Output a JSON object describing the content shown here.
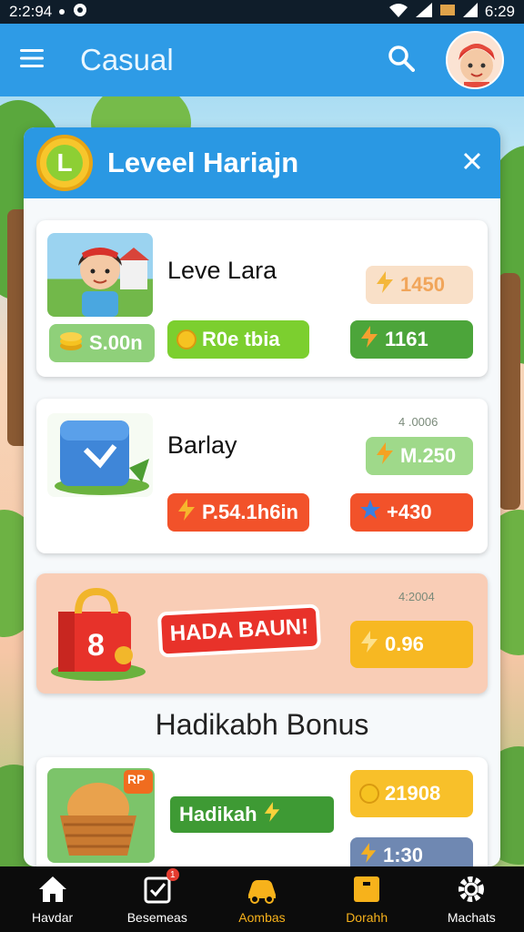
{
  "status_bar": {
    "time_left": "2:2:94",
    "time_right": "6:29"
  },
  "app_bar": {
    "title": "Casual"
  },
  "panel": {
    "title": "Leveel Hariajn",
    "badge_letter": "L",
    "cards": [
      {
        "name": "Leve Lara",
        "coin_pill": "S.00n",
        "mid_pill": "R0e tbia",
        "top_right_pill": "1450",
        "top_right_mini": "",
        "bottom_right_pill": "1161"
      },
      {
        "name": "Barlay",
        "mid_pill": "P.54.1h6in",
        "top_right_mini": "4 .0006",
        "top_right_pill": "M.250",
        "bottom_right_pill": "+430"
      },
      {
        "banner": "HADA BAUN!",
        "gift_number": "8",
        "top_right_mini": "4:2004",
        "right_pill": "0.96"
      },
      {
        "tag": "Hadikah",
        "corner_tag": "RP",
        "top_right_pill": "21908",
        "bottom_right_pill": "1:30"
      }
    ],
    "bonus_label": "Hadikabh Bonus"
  },
  "nav": {
    "items": [
      {
        "label": "Havdar",
        "icon": "home-icon",
        "active": false
      },
      {
        "label": "Besemeas",
        "icon": "checklist-icon",
        "active": false,
        "badge": "1"
      },
      {
        "label": "Aombas",
        "icon": "car-icon",
        "active": true
      },
      {
        "label": "Dorahh",
        "icon": "box-icon",
        "active": true
      },
      {
        "label": "Machats",
        "icon": "gear-icon",
        "active": false
      }
    ]
  },
  "colors": {
    "primary_blue": "#2e9be6",
    "green_pill": "#4caf3a",
    "orange_pill": "#f2522a",
    "yellow_pill": "#f7b822",
    "nav_active": "#f7b21b"
  }
}
